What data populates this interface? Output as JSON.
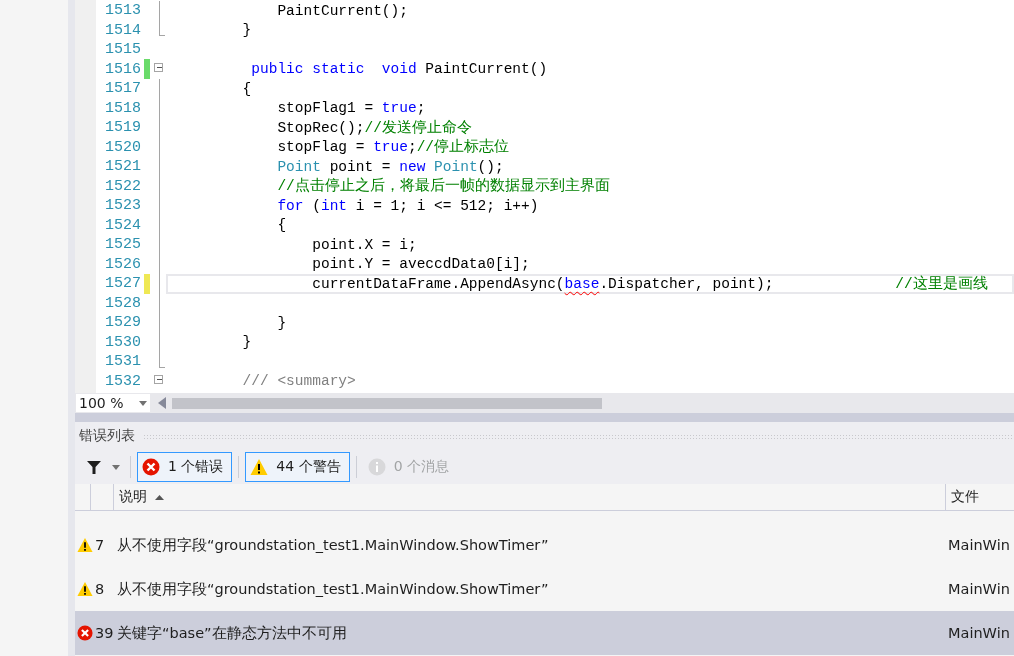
{
  "editor": {
    "lines": [
      {
        "number": "1513",
        "fold_toggle": false,
        "in_region": true,
        "region_end": false,
        "segments": [
          {
            "kind": "plain",
            "text": "            PaintCurrent();"
          }
        ]
      },
      {
        "number": "1514",
        "fold_toggle": false,
        "in_region": true,
        "region_end": true,
        "segments": [
          {
            "kind": "plain",
            "text": "        }"
          }
        ]
      },
      {
        "number": "1515",
        "fold_toggle": false,
        "in_region": false,
        "region_end": false
      },
      {
        "number": "1516",
        "fold_toggle": true,
        "in_region": false,
        "region_end": false,
        "marker": true,
        "saved": true,
        "segments": [
          {
            "kind": "keyword",
            "text": "         public static  void"
          },
          {
            "kind": "plain",
            "text": " PaintCurrent()"
          }
        ]
      },
      {
        "number": "1517",
        "fold_toggle": false,
        "in_region": true,
        "region_end": false,
        "segments": [
          {
            "kind": "plain",
            "text": "        {"
          }
        ]
      },
      {
        "number": "1518",
        "fold_toggle": false,
        "in_region": true,
        "region_end": false,
        "segments": [
          {
            "kind": "plain",
            "text": "            stopFlag1 = "
          },
          {
            "kind": "keyword",
            "text": "true"
          },
          {
            "kind": "plain",
            "text": ";"
          }
        ]
      },
      {
        "number": "1519",
        "fold_toggle": false,
        "in_region": true,
        "region_end": false,
        "segments": [
          {
            "kind": "plain",
            "text": "            StopRec();"
          },
          {
            "kind": "comment",
            "text": "//发送停止命令"
          }
        ]
      },
      {
        "number": "1520",
        "fold_toggle": false,
        "in_region": true,
        "region_end": false,
        "segments": [
          {
            "kind": "plain",
            "text": "            stopFlag = "
          },
          {
            "kind": "keyword",
            "text": "true"
          },
          {
            "kind": "plain",
            "text": ";"
          },
          {
            "kind": "comment",
            "text": "//停止标志位"
          }
        ]
      },
      {
        "number": "1521",
        "fold_toggle": false,
        "in_region": true,
        "region_end": false,
        "segments": [
          {
            "kind": "type",
            "text": "            Point"
          },
          {
            "kind": "plain",
            "text": " point = "
          },
          {
            "kind": "keyword",
            "text": "new"
          },
          {
            "kind": "type",
            "text": " Point"
          },
          {
            "kind": "plain",
            "text": "();"
          }
        ]
      },
      {
        "number": "1522",
        "fold_toggle": false,
        "in_region": true,
        "region_end": false,
        "segments": [
          {
            "kind": "comment",
            "text": "            //点击停止之后，将最后一帧的数据显示到主界面"
          }
        ]
      },
      {
        "number": "1523",
        "fold_toggle": false,
        "in_region": true,
        "region_end": false,
        "segments": [
          {
            "kind": "keyword",
            "text": "            for"
          },
          {
            "kind": "plain",
            "text": " ("
          },
          {
            "kind": "keyword",
            "text": "int"
          },
          {
            "kind": "plain",
            "text": " i = 1; i <= 512; i++)"
          }
        ]
      },
      {
        "number": "1524",
        "fold_toggle": false,
        "in_region": true,
        "region_end": false,
        "segments": [
          {
            "kind": "plain",
            "text": "            {"
          }
        ]
      },
      {
        "number": "1525",
        "fold_toggle": false,
        "in_region": true,
        "region_end": false,
        "segments": [
          {
            "kind": "plain",
            "text": "                point.X = i;"
          }
        ]
      },
      {
        "number": "1526",
        "fold_toggle": false,
        "in_region": true,
        "region_end": false,
        "segments": [
          {
            "kind": "plain",
            "text": "                point.Y = aveccdData0[i];"
          }
        ]
      },
      {
        "number": "1527",
        "fold_toggle": false,
        "in_region": true,
        "region_end": false,
        "marker": true,
        "saved": false,
        "current": true,
        "segments": [
          {
            "kind": "plain",
            "text": "                currentDataFrame.AppendAsync("
          },
          {
            "kind": "keyword",
            "text": "base",
            "error": true
          },
          {
            "kind": "plain",
            "text": ".Dispatcher, point);              "
          },
          {
            "kind": "comment",
            "text": "//这里是画线"
          }
        ]
      },
      {
        "number": "1528",
        "fold_toggle": false,
        "in_region": true,
        "region_end": false
      },
      {
        "number": "1529",
        "fold_toggle": false,
        "in_region": true,
        "region_end": false,
        "segments": [
          {
            "kind": "plain",
            "text": "            }"
          }
        ]
      },
      {
        "number": "1530",
        "fold_toggle": false,
        "in_region": true,
        "region_end": false,
        "segments": [
          {
            "kind": "plain",
            "text": "        }"
          }
        ]
      },
      {
        "number": "1531",
        "fold_toggle": false,
        "in_region": true,
        "region_end": true
      },
      {
        "number": "1532",
        "fold_toggle": true,
        "in_region": false,
        "region_end": false,
        "segments": [
          {
            "kind": "doc",
            "text": "        /// <summary>"
          }
        ]
      }
    ],
    "zoom": "100 %"
  },
  "error_list": {
    "title": "错误列表",
    "filters": [
      {
        "kind": "error",
        "label": "1 个错误",
        "selected": true,
        "disabled": false
      },
      {
        "kind": "warning",
        "label": "44 个警告",
        "selected": true,
        "disabled": false
      },
      {
        "kind": "info",
        "label": "0 个消息",
        "selected": false,
        "disabled": true
      }
    ],
    "columns": [
      {
        "label": "说明",
        "sorted_ascending": true
      },
      {
        "label": "文件"
      }
    ],
    "rows": [
      {
        "kind": "warning",
        "code": "7",
        "description": "从不使用字段“groundstation_test1.MainWindow.ShowTimer”",
        "file": "MainWin",
        "selected": false
      },
      {
        "kind": "warning",
        "code": "8",
        "description": "从不使用字段“groundstation_test1.MainWindow.ShowTimer”",
        "file": "MainWin",
        "selected": false
      },
      {
        "kind": "error",
        "code": "39",
        "description": "关键字“base”在静态方法中不可用",
        "file": "MainWin",
        "selected": true
      }
    ]
  }
}
